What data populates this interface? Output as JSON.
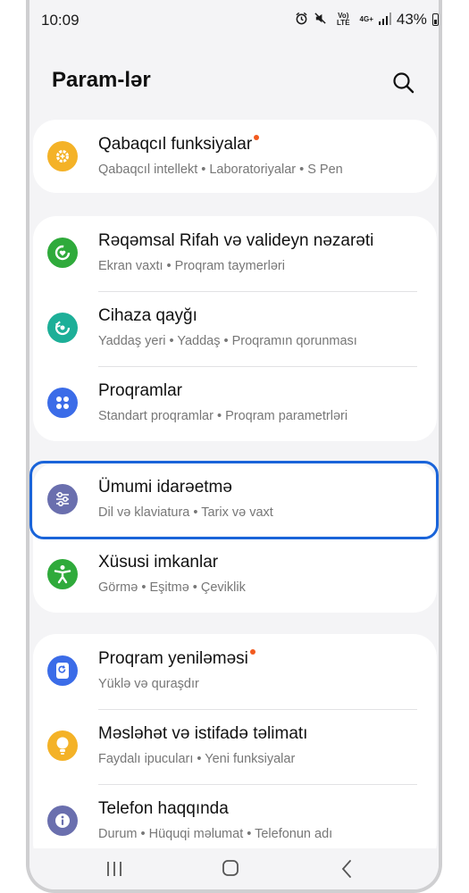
{
  "status_bar": {
    "time": "10:09",
    "vol_label": "Vo) LTE",
    "net_label": "4G+",
    "battery_pct": "43%"
  },
  "header": {
    "title": "Param-lər"
  },
  "groups": [
    {
      "items": [
        {
          "title": "Qabaqcıl funksiyalar",
          "subtitle": "Qabaqcıl intellekt  •  Laboratoriyalar  •  S Pen",
          "icon": "gear-plus-icon",
          "color": "#f4b227",
          "badge": true
        }
      ]
    },
    {
      "items": [
        {
          "title": "Rəqəmsal Rifah və valideyn nəzarəti",
          "subtitle": "Ekran vaxtı  •  Proqram taymerləri",
          "icon": "heart-circle-icon",
          "color": "#2faa3b",
          "badge": false
        },
        {
          "title": "Cihaza qayğı",
          "subtitle": "Yaddaş yeri  •  Yaddaş  •  Proqramın qorunması",
          "icon": "refresh-circle-icon",
          "color": "#1daf98",
          "badge": false
        },
        {
          "title": "Proqramlar",
          "subtitle": "Standart proqramlar  •  Proqram parametrləri",
          "icon": "apps-grid-icon",
          "color": "#3b6ce8",
          "badge": false
        }
      ]
    },
    {
      "items": [
        {
          "title": "Ümumi idarəetmə",
          "subtitle": "Dil və klaviatura  •  Tarix və vaxt",
          "icon": "sliders-icon",
          "color": "#6a6fae",
          "badge": false
        },
        {
          "title": "Xüsusi imkanlar",
          "subtitle": "Görmə  •  Eşitmə  •  Çeviklik",
          "icon": "accessibility-icon",
          "color": "#2faa3b",
          "badge": false
        }
      ]
    },
    {
      "items": [
        {
          "title": "Proqram yeniləməsi",
          "subtitle": "Yüklə və quraşdır",
          "icon": "update-icon",
          "color": "#3b6ce8",
          "badge": true
        },
        {
          "title": "Məsləhət və istifadə təlimatı",
          "subtitle": "Faydalı ipucuları  •  Yeni funksiyalar",
          "icon": "lightbulb-icon",
          "color": "#f4b227",
          "badge": false
        },
        {
          "title": "Telefon haqqında",
          "subtitle": "Durum  •  Hüquqi məlumat  •  Telefonun adı",
          "icon": "info-icon",
          "color": "#6a6fae",
          "badge": false
        }
      ]
    }
  ],
  "highlighted_item": "Ümumi idarəetmə",
  "nav": {
    "buttons": [
      "recent-apps",
      "home",
      "back"
    ]
  }
}
